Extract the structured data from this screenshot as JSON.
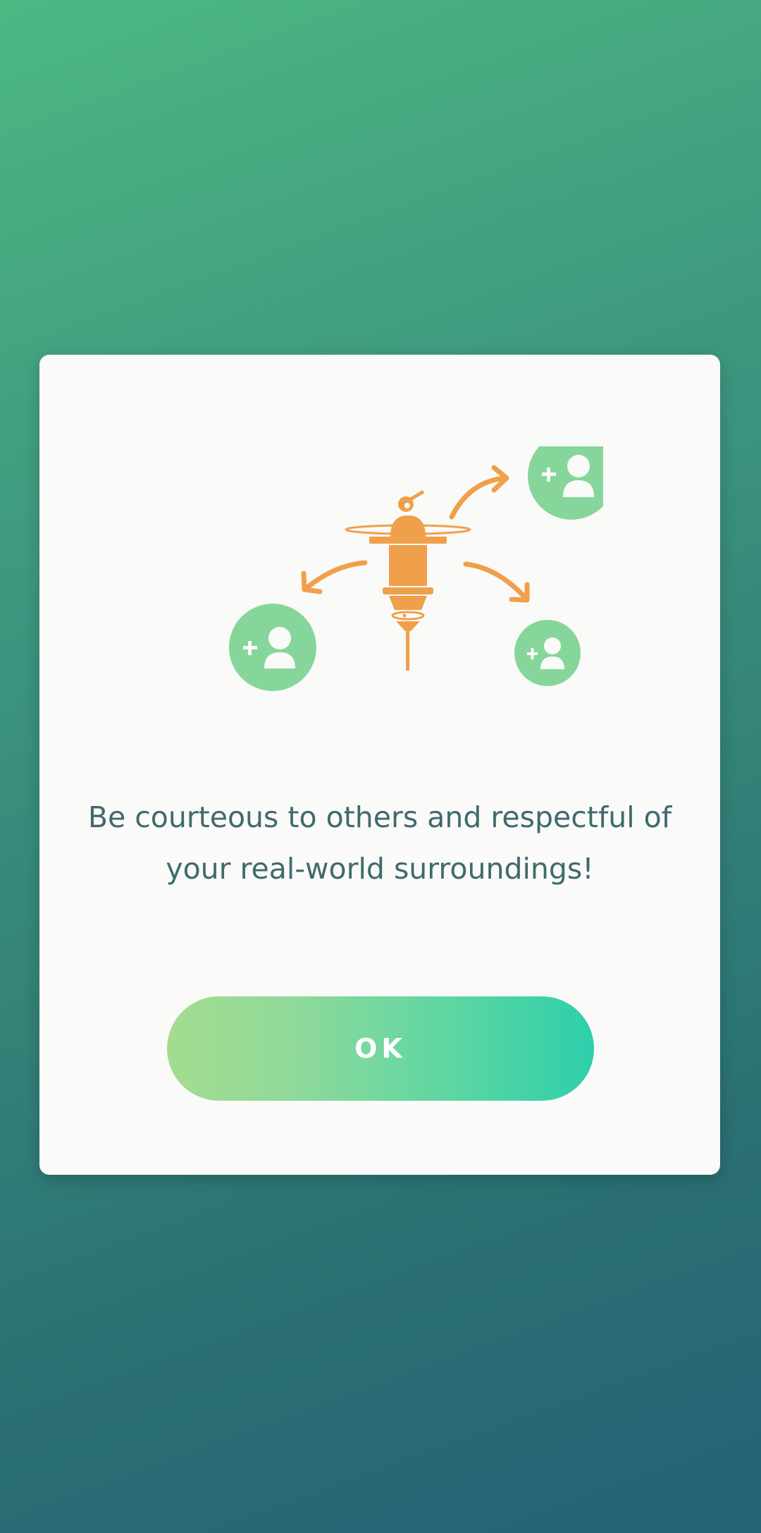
{
  "dialog": {
    "message": "Be courteous to others and respectful of your real-world surroundings!",
    "ok_label": "OK",
    "illustration": {
      "icons": [
        "pokestop-icon",
        "add-friend-icon",
        "arrow-icon"
      ]
    }
  },
  "colors": {
    "background_top": "#4cb882",
    "background_bottom": "#256276",
    "dialog_bg": "#fafaf8",
    "text": "#3f6a6e",
    "illustration_orange": "#f0a04a",
    "friend_green": "#86d69c",
    "button_start": "#a4dc90",
    "button_end": "#2dcfac"
  }
}
